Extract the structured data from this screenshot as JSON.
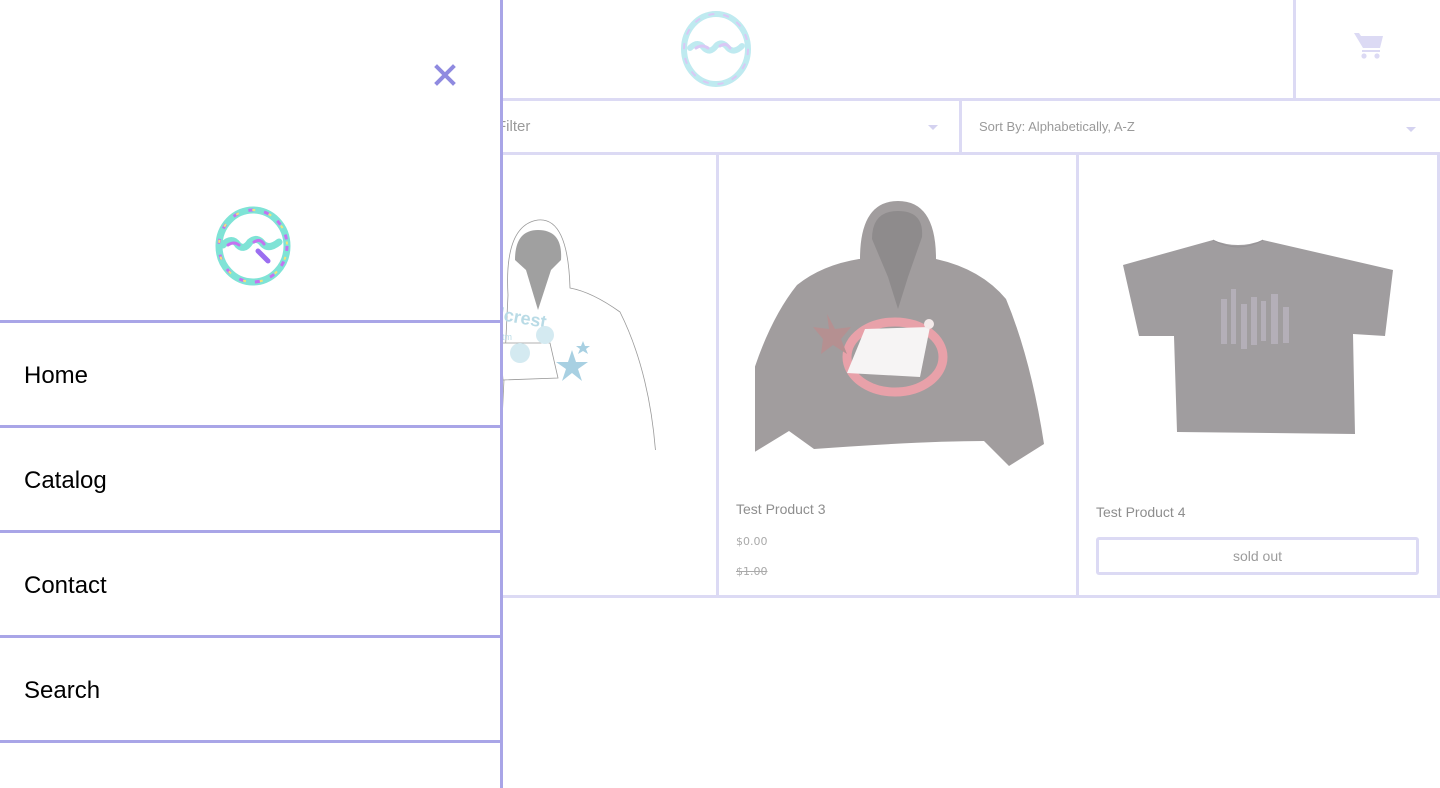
{
  "drawer": {
    "close_icon": "close-icon",
    "logo_icon": "brand-logo",
    "nav_items": [
      {
        "label": "Home"
      },
      {
        "label": "Catalog"
      },
      {
        "label": "Contact"
      },
      {
        "label": "Search"
      }
    ]
  },
  "header": {
    "logo_icon": "brand-logo",
    "cart_icon": "cart-icon"
  },
  "filters": {
    "filter_label": "Filter",
    "sort_label": "Sort By: Alphabetically, A-Z"
  },
  "products": [
    {
      "title": "",
      "image": "white-hoodie-partial"
    },
    {
      "title": "Test Product 3",
      "price": "$0.00",
      "compare_price": "$1.00",
      "image": "grey-hoodie"
    },
    {
      "title": "Test Product 4",
      "button": "sold out",
      "image": "grey-tshirt"
    }
  ],
  "colors": {
    "drawer_border": "#a9a5e7",
    "page_border": "#dcdaf4",
    "close_icon": "#8f8ae0"
  }
}
